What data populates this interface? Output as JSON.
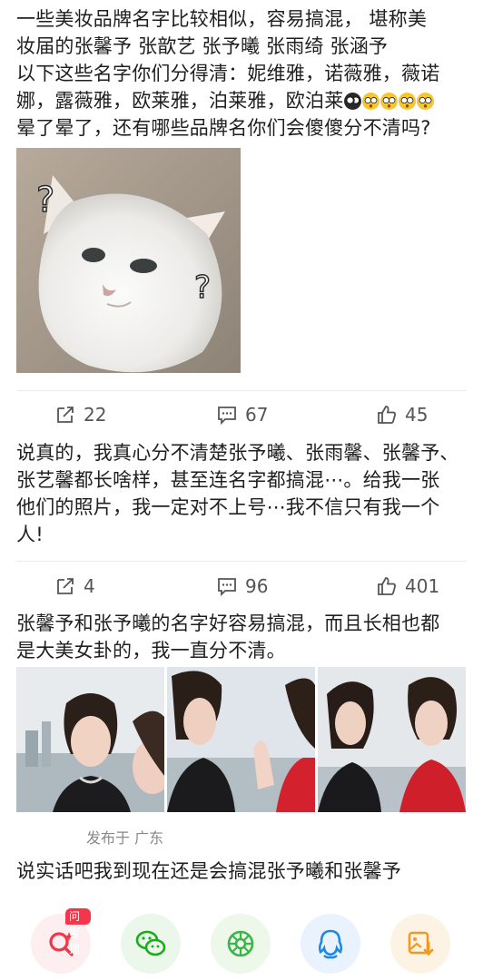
{
  "posts": [
    {
      "lines": [
        "一些美妆品牌名字比较相似，容易搞混， 堪称美",
        "妆届的张馨予 张歆艺 张予曦 张雨绮 张涵予",
        "以下这些名字你们分得清：妮维雅，诺薇雅，薇诺",
        "娜，露薇雅，欧莱雅，泊莱雅，欧泊莱",
        "晕了晕了，还有哪些品牌名你们会傻傻分不清吗?"
      ],
      "image_marks": [
        "?",
        "?"
      ],
      "share_count": "22",
      "comment_count": "67",
      "like_count": "45"
    },
    {
      "lines": [
        "说真的，我真心分不清楚张予曦、张雨馨、张馨予、",
        "张艺馨都长啥样，甚至连名字都搞混⋯。给我一张",
        "他们的照片，我一定对不上号⋯我不信只有我一个",
        "人!"
      ],
      "share_count": "4",
      "comment_count": "96",
      "like_count": "401"
    },
    {
      "lines": [
        "张馨予和张予曦的名字好容易搞混，而且长相也都",
        "是大美女卦的，我一直分不清。"
      ],
      "location": "发布于 广东"
    },
    {
      "lines": [
        "说实话吧我到现在还是会搞混张予曦和张馨予"
      ]
    }
  ],
  "share_bar": {
    "badge": "问智搜",
    "icons": [
      "search-sparkle-icon",
      "wechat-icon",
      "moments-icon",
      "qq-icon",
      "save-image-icon"
    ]
  },
  "colors": {
    "text": "#1f1f1f",
    "meta": "#555555",
    "search_red": "#f5364a",
    "wechat_green": "#1aad19",
    "qq_blue": "#1e88e5",
    "save_orange": "#f29a1f"
  }
}
